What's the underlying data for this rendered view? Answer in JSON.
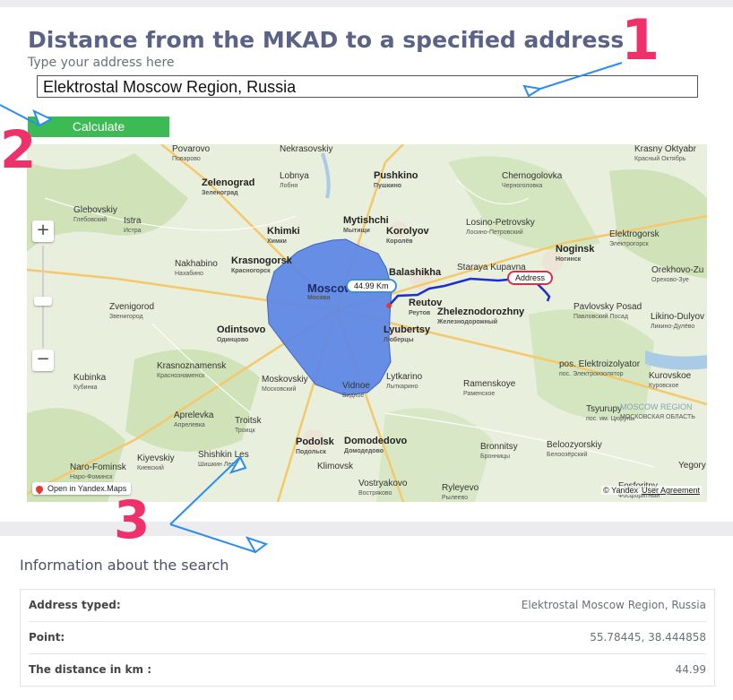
{
  "header": {
    "title": "Distance from the MKAD to a specified address",
    "address_label": "Type your address here"
  },
  "form": {
    "address_value": "Elektrostal Moscow Region, Russia",
    "calculate_label": "Calculate"
  },
  "map": {
    "distance_label": "44.99 Km",
    "address_marker_label": "Address",
    "open_in_maps_label": "Open in Yandex.Maps",
    "copyright": "© Yandex",
    "user_agreement": "User Agreement",
    "zoom_in": "+",
    "zoom_out": "−",
    "places": [
      {
        "en": "Povarovo",
        "ru": "Поварово"
      },
      {
        "en": "Nekrasovskiy",
        "ru": ""
      },
      {
        "en": "Zelenograd",
        "ru": "Зеленоград"
      },
      {
        "en": "Lobnya",
        "ru": "Лобня"
      },
      {
        "en": "Pushkino",
        "ru": "Пушкино"
      },
      {
        "en": "Chernogolovka",
        "ru": "Черноголовка"
      },
      {
        "en": "Krasny Oktyabr",
        "ru": "Красный Октябрь"
      },
      {
        "en": "Glebovskiy",
        "ru": "Глебовский"
      },
      {
        "en": "Istra",
        "ru": "Истра"
      },
      {
        "en": "Khimki",
        "ru": "Химки"
      },
      {
        "en": "Mytishchi",
        "ru": "Мытищи"
      },
      {
        "en": "Korolyov",
        "ru": "Королёв"
      },
      {
        "en": "Losino-Petrovsky",
        "ru": "Лосино-Петровский"
      },
      {
        "en": "Noginsk",
        "ru": "Ногинск"
      },
      {
        "en": "Elektrogorsk",
        "ru": "Электрогорск"
      },
      {
        "en": "Nakhabino",
        "ru": "Нахабино"
      },
      {
        "en": "Krasnogorsk",
        "ru": "Красногорск"
      },
      {
        "en": "Balashikha",
        "ru": ""
      },
      {
        "en": "Staraya Kupavna",
        "ru": ""
      },
      {
        "en": "Orekhovo-Zu",
        "ru": "Орехово-Зуе"
      },
      {
        "en": "Zvenigorod",
        "ru": "Звенигород"
      },
      {
        "en": "Moscow",
        "ru": "Москва"
      },
      {
        "en": "Reutov",
        "ru": "Реутов"
      },
      {
        "en": "Zheleznodorozhny",
        "ru": "Железнодорожный"
      },
      {
        "en": "Pavlovsky Posad",
        "ru": "Павловский Посад"
      },
      {
        "en": "Likino-Dulyov",
        "ru": "Ликино-Дулёво"
      },
      {
        "en": "Odintsovo",
        "ru": "Одинцово"
      },
      {
        "en": "Lyubertsy",
        "ru": "Люберцы"
      },
      {
        "en": "Krasnoznamensk",
        "ru": "Краснознаменск"
      },
      {
        "en": "Kubinka",
        "ru": "Кубинка"
      },
      {
        "en": "Moskovskiy",
        "ru": "Московский"
      },
      {
        "en": "Lytkarino",
        "ru": "Лыткарино"
      },
      {
        "en": "Ramenskoye",
        "ru": "Раменское"
      },
      {
        "en": "pos. Elektroizolyator",
        "ru": "пос. Электроизолятор"
      },
      {
        "en": "Kurovskoe",
        "ru": "Куровское"
      },
      {
        "en": "Vidnoe",
        "ru": "Видное"
      },
      {
        "en": "Aprelevka",
        "ru": "Апрелевка"
      },
      {
        "en": "Troitsk",
        "ru": "Троицк"
      },
      {
        "en": "Tsyurupy",
        "ru": "пос. им. Цюрупы"
      },
      {
        "en": "MOSCOW REGION",
        "ru": "МОСКОВСКАЯ ОБЛАСТЬ"
      },
      {
        "en": "Podolsk",
        "ru": "Подольск"
      },
      {
        "en": "Domodedovo",
        "ru": "Домодедово"
      },
      {
        "en": "Bronnitsy",
        "ru": "Бронницы"
      },
      {
        "en": "Beloozyorskiy",
        "ru": "Белоозёрский"
      },
      {
        "en": "Naro-Fominsk",
        "ru": "Наро-Фоминск"
      },
      {
        "en": "Kiyevskiy",
        "ru": "Киевский"
      },
      {
        "en": "Shishkin Les",
        "ru": "Шишкин Лес"
      },
      {
        "en": "Yegory",
        "ru": ""
      },
      {
        "en": "Klimovsk",
        "ru": ""
      },
      {
        "en": "Vostryakovo",
        "ru": "Востряково"
      },
      {
        "en": "Ryleyevo",
        "ru": "Рылеево"
      },
      {
        "en": "Fosforitny",
        "ru": "Фосфоритный"
      }
    ]
  },
  "annotations": {
    "one": "1",
    "two": "2",
    "three": "3"
  },
  "info": {
    "title": "Information about the search",
    "rows": [
      {
        "label": "Address typed:",
        "value": "Elektrostal Moscow Region, Russia"
      },
      {
        "label": "Point:",
        "value": "55.78445, 38.444858"
      },
      {
        "label": "The distance in km :",
        "value": "44.99"
      }
    ]
  },
  "colors": {
    "title": "#5a6288",
    "calculate_button": "#3cba54",
    "mkad_polygon": "#5b86e5",
    "route": "#1a2fcf",
    "annotation_number": "#f0306a",
    "annotation_arrow": "#2a8df0"
  }
}
